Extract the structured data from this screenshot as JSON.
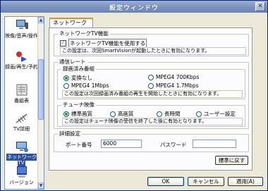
{
  "window": {
    "title": "設定ウィンドウ",
    "close_glyph": "✕"
  },
  "sidebar": {
    "items": [
      {
        "label": "映像/音声/操作",
        "icon": "monitor-speaker-icon",
        "selected": false
      },
      {
        "label": "録画/再生/予約",
        "icon": "record-play-icon",
        "selected": false
      },
      {
        "label": "番組表",
        "icon": "program-guide-icon",
        "selected": false
      },
      {
        "label": "TV詳細",
        "icon": "antenna-icon",
        "selected": false
      },
      {
        "label": "ネットワークTV",
        "icon": "network-tv-icon",
        "selected": true
      },
      {
        "label": "バージョン",
        "icon": "version-icon",
        "selected": false
      }
    ],
    "scroll_up": "▲",
    "scroll_down": "▼"
  },
  "tabs": [
    {
      "label": "ネットワークTV",
      "active": true
    }
  ],
  "network_feature": {
    "title": "ネットワークTV機能",
    "checkbox_label": "ネットワークTV機能を使用する",
    "checked": true,
    "note": "この設定は、次回SmartVisionが起動したときに有効になります。"
  },
  "transfer_rate": {
    "title": "通信レート",
    "recorded": {
      "title": "録画済み番組",
      "options": [
        "変換なし",
        "MPEG4 700Kbps",
        "MPEG4 1Mbps",
        "MPEG4 1.7Mbps"
      ],
      "selected": "変換なし",
      "note": "この設定は次回録画済み番組の再生を開始したときに有効になります。"
    },
    "tuner": {
      "title": "チューナ映像",
      "options": [
        "標準画質",
        "高画質",
        "長時間",
        "ユーザー設定"
      ],
      "selected": "標準画質",
      "note": "この設定はチューナ映像の受信を終了した後に有効となります。"
    }
  },
  "advanced": {
    "title": "詳細設定",
    "port_label": "ポート番号",
    "port_value": "6000",
    "password_label": "パスワード",
    "password_value": ""
  },
  "buttons": {
    "restore_default": "標準に戻す",
    "ok": "OK",
    "cancel": "キャンセル",
    "apply": "適用(A)"
  }
}
